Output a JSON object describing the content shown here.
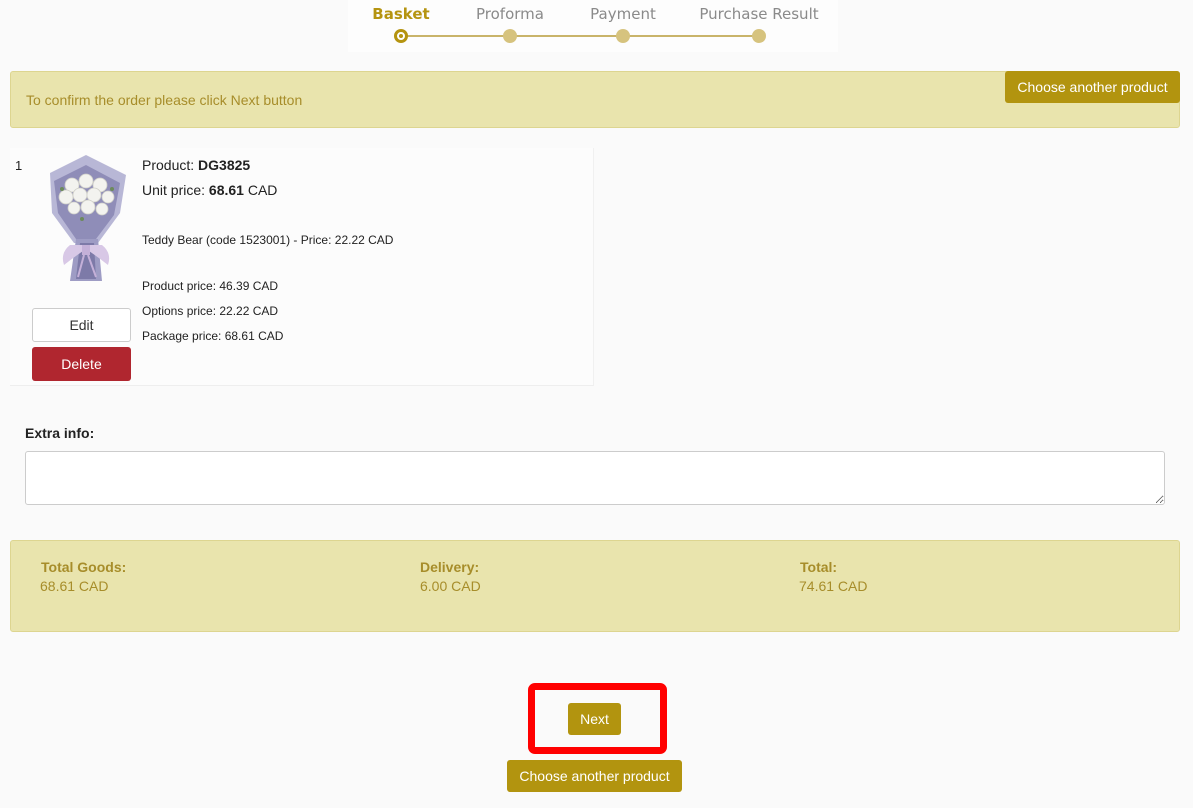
{
  "stepper": {
    "steps": [
      {
        "label": "Basket",
        "active": true
      },
      {
        "label": "Proforma",
        "active": false
      },
      {
        "label": "Payment",
        "active": false
      },
      {
        "label": "Purchase Result",
        "active": false
      }
    ]
  },
  "notice": {
    "text": "To confirm the order please click Next button",
    "choose_button": "Choose another product"
  },
  "basket_item": {
    "index": "1",
    "product_label": "Product:",
    "product_code": "DG3825",
    "unit_price_label": "Unit price:",
    "unit_price_value": "68.61",
    "unit_price_currency": "CAD",
    "option_line": "Teddy Bear (code 1523001) - Price: 22.22 CAD",
    "product_price": "Product price: 46.39 CAD",
    "options_price": "Options price: 22.22 CAD",
    "package_price": "Package price: 68.61 CAD",
    "edit_button": "Edit",
    "delete_button": "Delete",
    "image_icon": "flower-bouquet-image"
  },
  "extra_info": {
    "label": "Extra info:",
    "value": ""
  },
  "totals": {
    "goods_label": "Total Goods:",
    "goods_value": "68.61 CAD",
    "delivery_label": "Delivery:",
    "delivery_value": "6.00 CAD",
    "total_label": "Total:",
    "total_value": "74.61 CAD"
  },
  "actions": {
    "next_button": "Next",
    "choose_button": "Choose another product"
  },
  "colors": {
    "accent": "#b2940f",
    "panel": "#e9e4ad",
    "panel_text": "#a78d2a",
    "danger": "#b0262f",
    "highlight": "#ff0000"
  }
}
